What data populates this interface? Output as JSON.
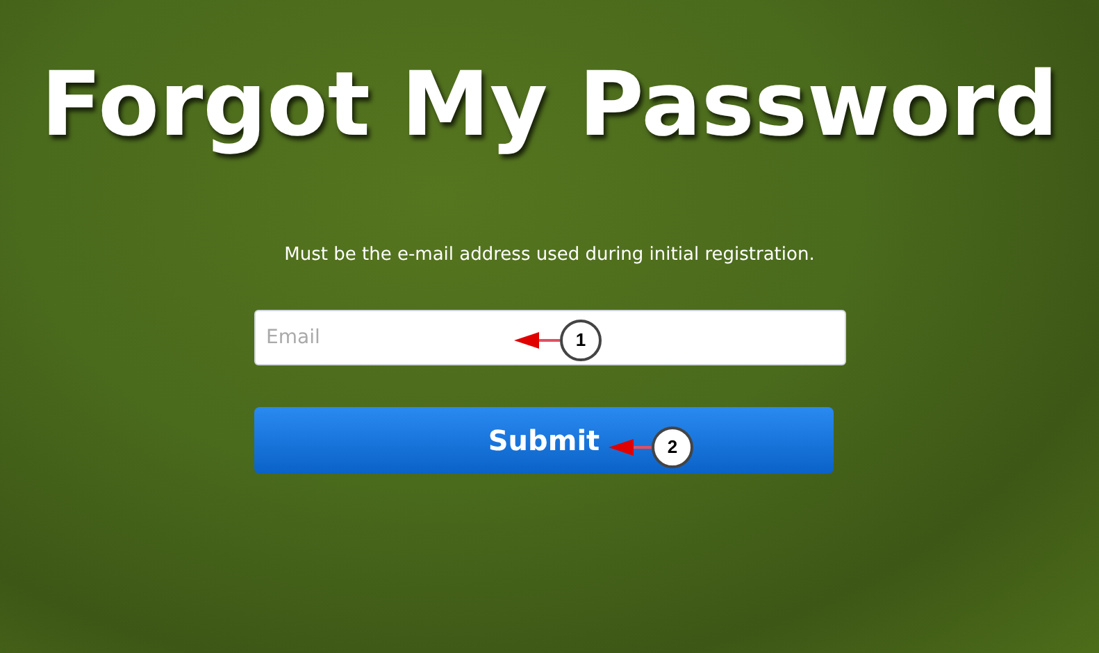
{
  "title": "Forgot My Password",
  "hint": "Must be the e-mail address used during initial registration.",
  "email_field": {
    "placeholder": "Email"
  },
  "submit_button": {
    "label": "Submit"
  },
  "callouts": [
    {
      "number": "1"
    },
    {
      "number": "2"
    }
  ]
}
